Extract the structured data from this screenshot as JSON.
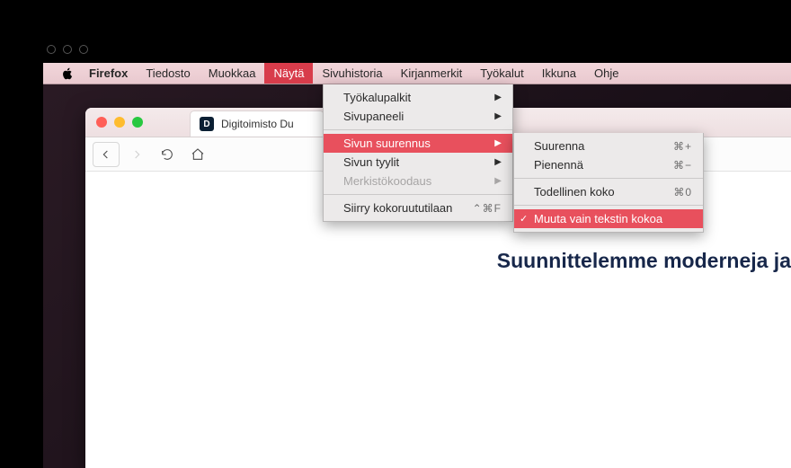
{
  "outer_window": {
    "tooltip": "macOS window controls"
  },
  "menubar": {
    "app": "Firefox",
    "items": [
      "Tiedosto",
      "Muokkaa",
      "Näytä",
      "Sivuhistoria",
      "Kirjanmerkit",
      "Työkalut",
      "Ikkuna",
      "Ohje"
    ],
    "active_index": 2
  },
  "menu_view": {
    "toolbars": "Työkalupalkit",
    "sidebar": "Sivupaneeli",
    "zoom": "Sivun suurennus",
    "styles": "Sivun tyylit",
    "encoding": "Merkistökoodaus",
    "fullscreen": "Siirry kokoruututilaan",
    "fullscreen_key": "⌃⌘F"
  },
  "menu_zoom": {
    "zoom_in": "Suurenna",
    "zoom_in_key": "⌘+",
    "zoom_out": "Pienennä",
    "zoom_out_key": "⌘−",
    "actual": "Todellinen koko",
    "actual_key": "⌘0",
    "text_only": "Muuta vain tekstin kokoa",
    "text_only_checked": "✓"
  },
  "browser": {
    "tab_title": "Digitoimisto Du",
    "favicon_letter": "D"
  },
  "page": {
    "heading": "Suunnittelemme moderneja ja"
  }
}
